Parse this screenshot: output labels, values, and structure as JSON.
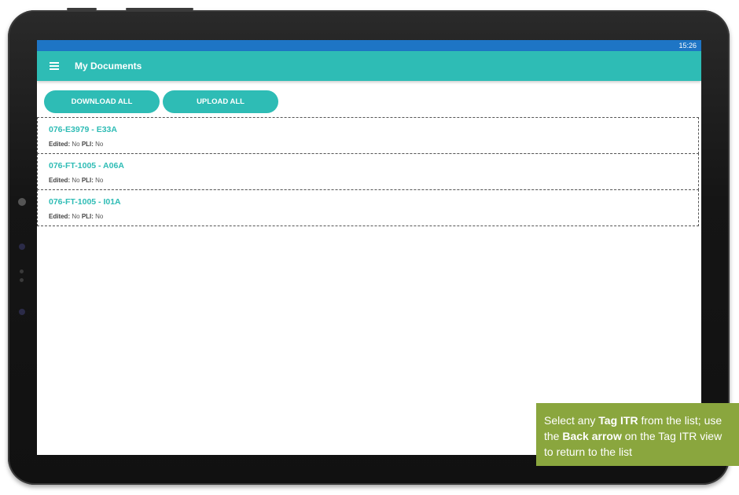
{
  "status_bar": {
    "time": "15:26"
  },
  "app_bar": {
    "title": "My Documents",
    "menu_icon": "hamburger-menu-icon"
  },
  "actions": {
    "download_all": "DOWNLOAD ALL",
    "upload_all": "UPLOAD ALL"
  },
  "documents": [
    {
      "title": "076-E3979 - E33A",
      "edited_label": "Edited:",
      "edited_value": "No",
      "pli_label": "PLI:",
      "pli_value": "No"
    },
    {
      "title": "076-FT-1005 - A06A",
      "edited_label": "Edited:",
      "edited_value": "No",
      "pli_label": "PLI:",
      "pli_value": "No"
    },
    {
      "title": "076-FT-1005 - I01A",
      "edited_label": "Edited:",
      "edited_value": "No",
      "pli_label": "PLI:",
      "pli_value": "No"
    }
  ],
  "callout": {
    "part1": "Select any ",
    "bold1": "Tag ITR",
    "part2": " from the list; use the ",
    "bold2": "Back arrow",
    "part3": " on the Tag ITR view to return to the list"
  },
  "colors": {
    "accent": "#2ebcb5",
    "status_bar": "#1e75c5",
    "callout": "#8aa63e"
  }
}
